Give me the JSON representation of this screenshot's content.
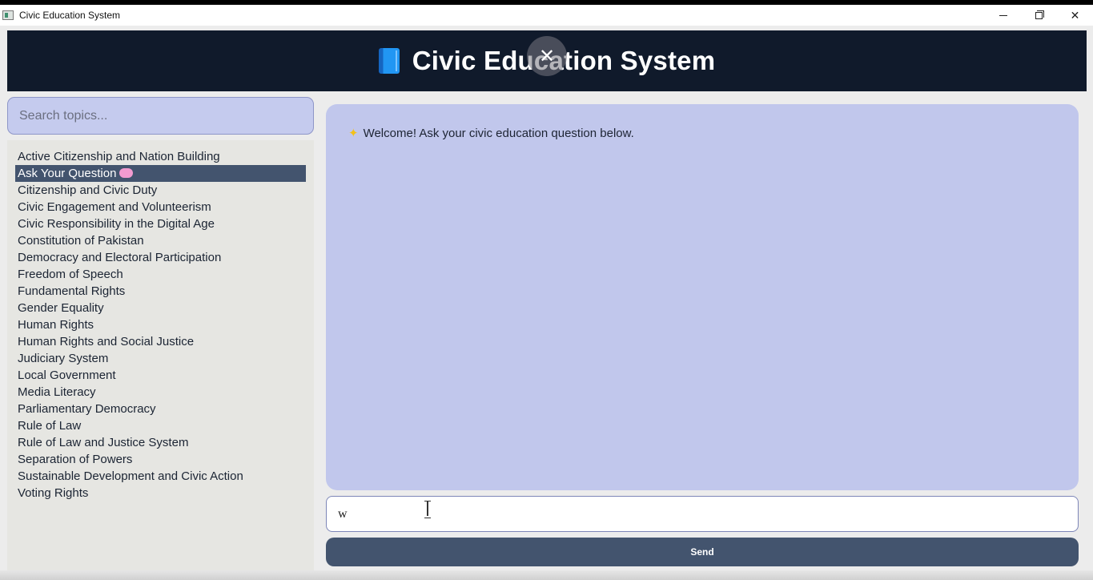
{
  "window": {
    "title": "Civic Education System",
    "controls": {
      "minimize": "",
      "maximize": "",
      "close": "✕"
    }
  },
  "header": {
    "icon": "blue-book-icon",
    "title": "Civic Education System",
    "overlay_close": "✕"
  },
  "sidebar": {
    "search_placeholder": "Search topics...",
    "topics": [
      {
        "label": "Active Citizenship and Nation Building"
      },
      {
        "label": "Ask Your Question",
        "icon": "brain-icon",
        "selected": true
      },
      {
        "label": "Citizenship and Civic Duty"
      },
      {
        "label": "Civic Engagement and Volunteerism"
      },
      {
        "label": "Civic Responsibility in the Digital Age"
      },
      {
        "label": "Constitution of Pakistan"
      },
      {
        "label": "Democracy and Electoral Participation"
      },
      {
        "label": "Freedom of Speech"
      },
      {
        "label": "Fundamental Rights"
      },
      {
        "label": "Gender Equality"
      },
      {
        "label": "Human Rights"
      },
      {
        "label": "Human Rights and Social Justice"
      },
      {
        "label": "Judiciary System"
      },
      {
        "label": "Local Government"
      },
      {
        "label": "Media Literacy"
      },
      {
        "label": "Parliamentary Democracy"
      },
      {
        "label": "Rule of Law"
      },
      {
        "label": "Rule of Law and Justice System"
      },
      {
        "label": "Separation of Powers"
      },
      {
        "label": "Sustainable Development and Civic Action"
      },
      {
        "label": "Voting Rights"
      }
    ]
  },
  "chat": {
    "welcome_icon": "sparkle-icon",
    "welcome_text": "Welcome! Ask your civic education question below.",
    "input_value": "w",
    "send_label": "Send"
  },
  "colors": {
    "header_bg": "#101a2b",
    "accent": "#43546e",
    "chat_bg": "#c1c7ec",
    "search_bg": "#c5cbee"
  }
}
